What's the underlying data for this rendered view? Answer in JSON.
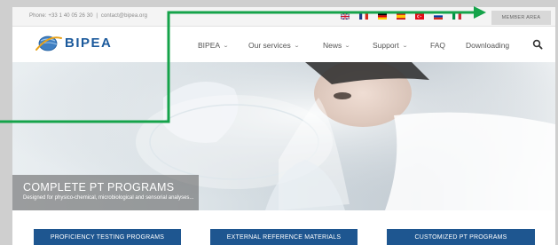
{
  "topbar": {
    "phone": "Phone: +33 1 40 05 26 30",
    "separator": "|",
    "email": "contact@bipea.org",
    "member_area": "MEMBER AREA"
  },
  "languages": [
    {
      "icon": "flag-uk-icon",
      "colors": [
        "#1f3f8a",
        "#ffffff",
        "#c8102e"
      ]
    },
    {
      "icon": "flag-fr-icon",
      "colors": [
        "#1f3f8a",
        "#ffffff",
        "#d52b1e"
      ]
    },
    {
      "icon": "flag-de-icon",
      "colors": [
        "#000000",
        "#dd0000",
        "#ffce00"
      ]
    },
    {
      "icon": "flag-es-icon",
      "colors": [
        "#c60b1e",
        "#ffc400",
        "#c60b1e"
      ]
    },
    {
      "icon": "flag-tr-icon",
      "colors": [
        "#e30a17",
        "#e30a17",
        "#e30a17"
      ]
    },
    {
      "icon": "flag-ru-icon",
      "colors": [
        "#ffffff",
        "#0039a6",
        "#d52b1e"
      ]
    },
    {
      "icon": "flag-it-icon",
      "colors": [
        "#009246",
        "#ffffff",
        "#ce2b37"
      ]
    }
  ],
  "brand": {
    "name": "BIPEA",
    "logo_icon": "bipea-globe-icon",
    "color": "#1c5a9c"
  },
  "nav": {
    "items": [
      {
        "label": "BIPEA",
        "has_dropdown": true
      },
      {
        "label": "Our services",
        "has_dropdown": true
      },
      {
        "label": "News",
        "has_dropdown": true
      },
      {
        "label": "Support",
        "has_dropdown": true
      },
      {
        "label": "FAQ",
        "has_dropdown": false
      },
      {
        "label": "Downloading",
        "has_dropdown": false
      }
    ],
    "chevron": "⌄",
    "search_icon": "search-icon"
  },
  "hero": {
    "title": "COMPLETE PT PROGRAMS",
    "subtitle": "Designed for physico-chemical, microbiological and sensorial analyses..."
  },
  "cta": {
    "buttons": [
      "PROFICIENCY TESTING PROGRAMS",
      "EXTERNAL REFERENCE MATERIALS",
      "CUSTOMIZED PT PROGRAMS"
    ],
    "color": "#1e5690"
  },
  "annotation": {
    "color": "#15a34a",
    "icon": "arrow-right-icon"
  }
}
